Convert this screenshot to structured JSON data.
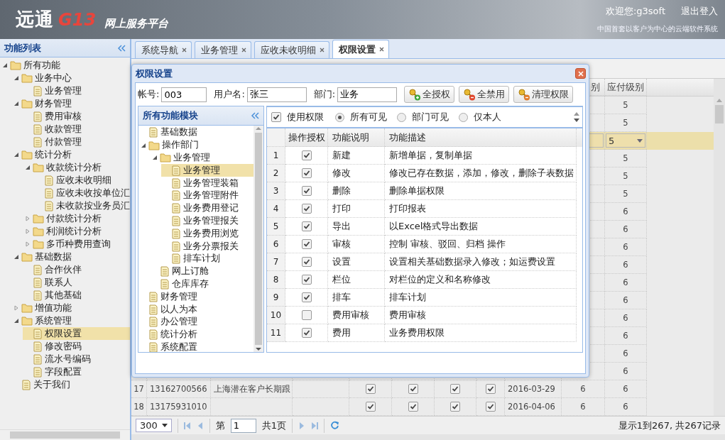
{
  "header": {
    "logo_text": "远通",
    "logo_mark": "G13",
    "platform": "网上服务平台",
    "welcome": "欢迎您:g3soft",
    "logout": "退出登入",
    "slogan": "中国首套以客户为中心的云端软件系统"
  },
  "sidebar": {
    "title": "功能列表",
    "items": [
      {
        "label": "所有功能",
        "kind": "folder",
        "expanded": true,
        "selected": false,
        "children": [
          {
            "label": "业务中心",
            "kind": "folder",
            "expanded": true,
            "selected": false,
            "children": [
              {
                "label": "业务管理",
                "kind": "leaf",
                "selected": false
              }
            ]
          },
          {
            "label": "财务管理",
            "kind": "folder",
            "expanded": true,
            "selected": false,
            "children": [
              {
                "label": "费用审核",
                "kind": "leaf",
                "selected": false
              },
              {
                "label": "收款管理",
                "kind": "leaf",
                "selected": false
              },
              {
                "label": "付款管理",
                "kind": "leaf",
                "selected": false
              }
            ]
          },
          {
            "label": "统计分析",
            "kind": "folder",
            "expanded": true,
            "selected": false,
            "children": [
              {
                "label": "收款统计分析",
                "kind": "folder",
                "expanded": true,
                "selected": false,
                "children": [
                  {
                    "label": "应收未收明细",
                    "kind": "leaf",
                    "selected": false
                  },
                  {
                    "label": "应收未收按单位汇",
                    "kind": "leaf",
                    "selected": false
                  },
                  {
                    "label": "未收款按业务员汇",
                    "kind": "leaf",
                    "selected": false
                  }
                ]
              },
              {
                "label": "付款统计分析",
                "kind": "folder",
                "expanded": false,
                "selected": false
              },
              {
                "label": "利润统计分析",
                "kind": "folder",
                "expanded": false,
                "selected": false
              },
              {
                "label": "多币种费用查询",
                "kind": "folder",
                "expanded": false,
                "selected": false
              }
            ]
          },
          {
            "label": "基础数据",
            "kind": "folder",
            "expanded": true,
            "selected": false,
            "children": [
              {
                "label": "合作伙伴",
                "kind": "leaf",
                "selected": false
              },
              {
                "label": "联系人",
                "kind": "leaf",
                "selected": false
              },
              {
                "label": "其他基础",
                "kind": "leaf",
                "selected": false
              }
            ]
          },
          {
            "label": "增值功能",
            "kind": "folder",
            "expanded": false,
            "selected": false
          },
          {
            "label": "系统管理",
            "kind": "folder",
            "expanded": true,
            "selected": false,
            "children": [
              {
                "label": "权限设置",
                "kind": "leaf",
                "selected": true
              },
              {
                "label": "修改密码",
                "kind": "leaf",
                "selected": false
              },
              {
                "label": "流水号编码",
                "kind": "leaf",
                "selected": false
              },
              {
                "label": "字段配置",
                "kind": "leaf",
                "selected": false
              }
            ]
          },
          {
            "label": "关于我们",
            "kind": "leaf",
            "selected": false
          }
        ]
      }
    ]
  },
  "tabs": [
    {
      "label": "系统导航",
      "selected": false
    },
    {
      "label": "业务管理",
      "selected": false
    },
    {
      "label": "应收未收明细",
      "selected": false
    },
    {
      "label": "权限设置",
      "selected": true
    }
  ],
  "grid": {
    "columns": [
      "别",
      "应付级别"
    ],
    "rows": [
      {
        "level_b": "5",
        "selected": false
      },
      {
        "level_b": "5",
        "selected": false
      },
      {
        "level_b": "5",
        "selected": true
      },
      {
        "level_b": "5",
        "selected": false
      },
      {
        "level_b": "5",
        "selected": false
      },
      {
        "level_b": "5",
        "selected": false
      },
      {
        "level_b": "6",
        "selected": false
      },
      {
        "level_b": "6",
        "selected": false
      },
      {
        "level_b": "6",
        "selected": false
      },
      {
        "level_b": "6",
        "selected": false
      },
      {
        "level_b": "6",
        "selected": false
      },
      {
        "level_b": "6",
        "selected": false
      },
      {
        "level_b": "6",
        "selected": false
      },
      {
        "level_b": "6",
        "selected": false
      },
      {
        "level_b": "6",
        "selected": false
      },
      {
        "level_b": "6",
        "selected": false
      },
      {
        "number": "17",
        "phone": "13162700566",
        "name": "上海潜在客户长期跟",
        "checks": [
          true,
          true,
          true,
          true
        ],
        "date": "2016-03-29",
        "level_a": "6",
        "level_b": "6",
        "selected": false
      },
      {
        "number": "18",
        "phone": "13175931010",
        "checks": [
          true,
          true,
          true,
          true
        ],
        "date": "2016-04-06",
        "level_a": "6",
        "level_b": "6",
        "selected": false
      }
    ]
  },
  "pager": {
    "page_size": "300",
    "page_label": "第",
    "page": "1",
    "page_total": "共1页",
    "summary": "显示1到267, 共267记录"
  },
  "dialog": {
    "title": "权限设置",
    "fields": [
      {
        "label": "帐号:",
        "value": "003"
      },
      {
        "label": "用户名:",
        "value": "张三"
      },
      {
        "label": "部门:",
        "value": "业务"
      }
    ],
    "buttons": [
      {
        "label": "全授权",
        "kind": "grant"
      },
      {
        "label": "全禁用",
        "kind": "deny"
      },
      {
        "label": "清理权限",
        "kind": "clear"
      }
    ],
    "module_tree": {
      "title": "所有功能模块",
      "items": [
        {
          "label": "基础数据",
          "kind": "leaf",
          "selected": false
        },
        {
          "label": "操作部门",
          "kind": "folder",
          "expanded": true,
          "selected": false,
          "children": [
            {
              "label": "业务管理",
              "kind": "folder",
              "expanded": true,
              "selected": false,
              "children": [
                {
                  "label": "业务管理",
                  "kind": "leaf",
                  "selected": true
                },
                {
                  "label": "业务管理装箱",
                  "kind": "leaf",
                  "selected": false
                },
                {
                  "label": "业务管理附件",
                  "kind": "leaf",
                  "selected": false
                },
                {
                  "label": "业务费用登记",
                  "kind": "leaf",
                  "selected": false
                },
                {
                  "label": "业务管理报关",
                  "kind": "leaf",
                  "selected": false
                },
                {
                  "label": "业务费用浏览",
                  "kind": "leaf",
                  "selected": false
                },
                {
                  "label": "业务分票报关",
                  "kind": "leaf",
                  "selected": false
                },
                {
                  "label": "排车计划",
                  "kind": "leaf",
                  "selected": false
                }
              ]
            },
            {
              "label": "网上订舱",
              "kind": "leaf",
              "selected": false
            },
            {
              "label": "仓库库存",
              "kind": "leaf",
              "selected": false
            }
          ]
        },
        {
          "label": "财务管理",
          "kind": "leaf",
          "selected": false
        },
        {
          "label": "以人为本",
          "kind": "leaf",
          "selected": false
        },
        {
          "label": "办公管理",
          "kind": "leaf",
          "selected": false
        },
        {
          "label": "统计分析",
          "kind": "leaf",
          "selected": false
        },
        {
          "label": "系统配置",
          "kind": "leaf",
          "selected": false
        }
      ]
    },
    "use_permission": {
      "label": "使用权限",
      "checked": true
    },
    "scope_options": [
      {
        "label": "所有可见",
        "selected": true
      },
      {
        "label": "部门可见",
        "selected": false
      },
      {
        "label": "仅本人",
        "selected": false
      }
    ],
    "table": {
      "columns": [
        "操作授权",
        "功能说明",
        "功能描述"
      ],
      "rows": [
        {
          "number": "1",
          "granted": true,
          "name": "新建",
          "description": "新增单据，复制单据"
        },
        {
          "number": "2",
          "granted": true,
          "name": "修改",
          "description": "修改已存在数据，添加，修改，删除子表数据"
        },
        {
          "number": "3",
          "granted": true,
          "name": "删除",
          "description": "删除单据权限"
        },
        {
          "number": "4",
          "granted": true,
          "name": "打印",
          "description": "打印报表"
        },
        {
          "number": "5",
          "granted": true,
          "name": "导出",
          "description": "以Excel格式导出数据"
        },
        {
          "number": "6",
          "granted": true,
          "name": "审核",
          "description": "控制 审核、驳回、归档 操作"
        },
        {
          "number": "7",
          "granted": true,
          "name": "设置",
          "description": "设置相关基础数据录入修改；如运费设置"
        },
        {
          "number": "8",
          "granted": true,
          "name": "栏位",
          "description": "对栏位的定义和名称修改"
        },
        {
          "number": "9",
          "granted": true,
          "name": "排车",
          "description": "排车计划"
        },
        {
          "number": "10",
          "granted": false,
          "name": "费用审核",
          "description": "费用审核"
        },
        {
          "number": "11",
          "granted": true,
          "name": "费用",
          "description": "业务费用权限"
        }
      ]
    }
  }
}
